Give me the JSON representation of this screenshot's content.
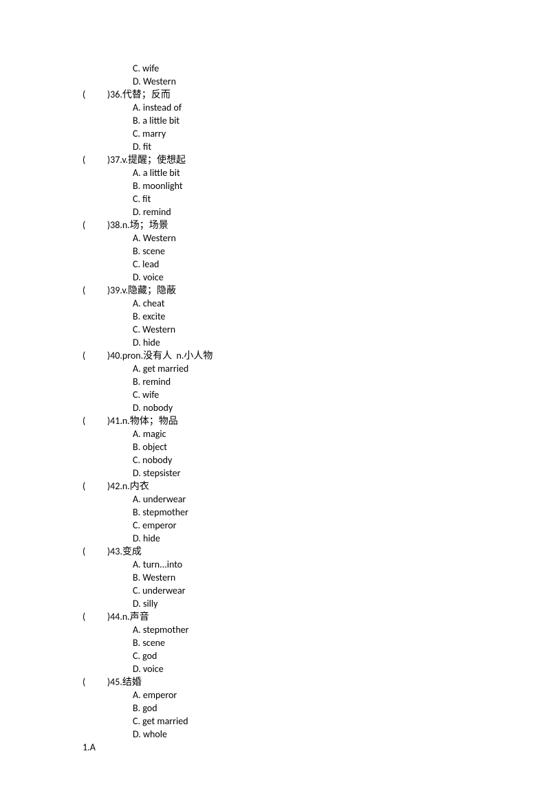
{
  "preOptions": [
    "C. wife",
    "D. Western"
  ],
  "questions": [
    {
      "num": "36",
      "prompt": ".代替；反而",
      "options": [
        "A. instead of",
        "B. a little bit",
        "C. marry",
        "D. fit"
      ]
    },
    {
      "num": "37",
      "prompt": ".v.提醒；使想起",
      "options": [
        "A. a little bit",
        "B. moonlight",
        "C. fit",
        "D. remind"
      ]
    },
    {
      "num": "38",
      "prompt": ".n.场；场景",
      "options": [
        "A. Western",
        "B. scene",
        "C. lead",
        "D. voice"
      ]
    },
    {
      "num": "39",
      "prompt": ".v.隐藏；隐蔽",
      "options": [
        "A. cheat",
        "B. excite",
        "C. Western",
        "D. hide"
      ]
    },
    {
      "num": "40",
      "prompt": ".pron.没有人  n.小人物",
      "options": [
        "A. get married",
        "B. remind",
        "C. wife",
        "D. nobody"
      ]
    },
    {
      "num": "41",
      "prompt": ".n.物体；物品",
      "options": [
        "A. magic",
        "B. object",
        "C. nobody",
        "D. stepsister"
      ]
    },
    {
      "num": "42",
      "prompt": ".n.内衣",
      "options": [
        "A. underwear",
        "B. stepmother",
        "C. emperor",
        "D. hide"
      ]
    },
    {
      "num": "43",
      "prompt": ".变成",
      "options": [
        "A. turn...into",
        "B. Western",
        "C. underwear",
        "D. silly"
      ]
    },
    {
      "num": "44",
      "prompt": ".n.声音",
      "options": [
        "A. stepmother",
        "B. scene",
        "C. god",
        "D. voice"
      ]
    },
    {
      "num": "45",
      "prompt": ".结婚",
      "options": [
        "A. emperor",
        "B. god",
        "C. get married",
        "D. whole"
      ]
    }
  ],
  "answerLine": "1.A",
  "blankPrefix": "(          )"
}
